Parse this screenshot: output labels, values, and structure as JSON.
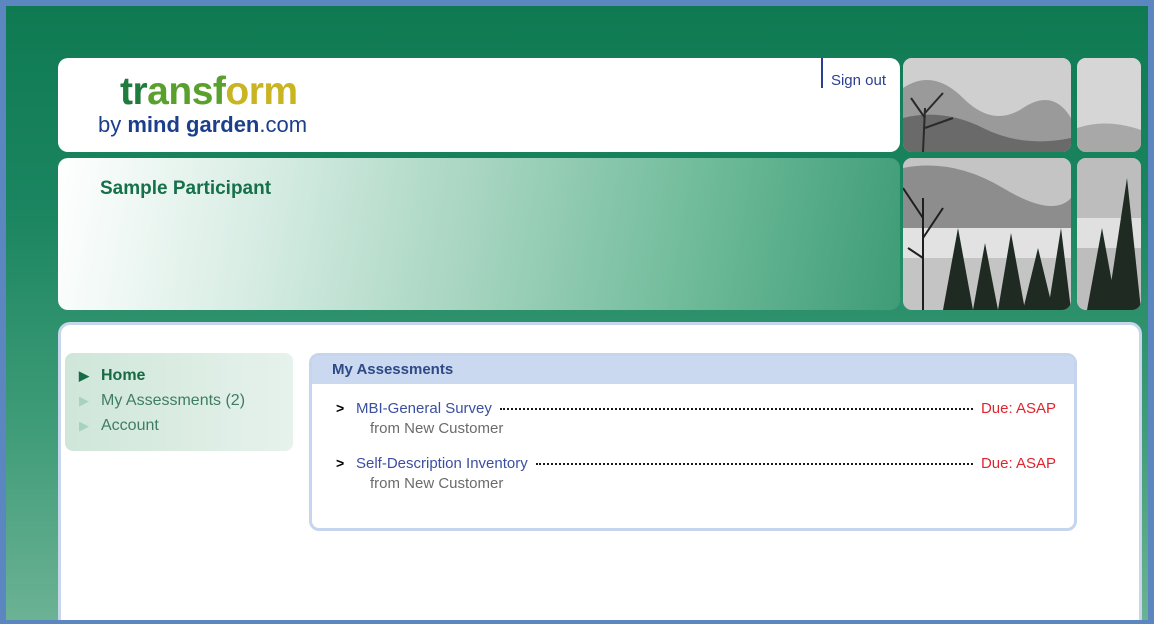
{
  "header": {
    "logo": {
      "word": [
        "tr",
        "a",
        "nsf",
        "o",
        "rm"
      ],
      "byline_prefix": "by ",
      "byline_bold": "mind garden",
      "byline_suffix": ".com"
    },
    "sign_out_label": "Sign out"
  },
  "banner": {
    "participant_name": "Sample Participant"
  },
  "nav": {
    "items": [
      {
        "label": "Home",
        "active": true
      },
      {
        "label": "My Assessments (2)",
        "active": false
      },
      {
        "label": "Account",
        "active": false
      }
    ]
  },
  "assessments": {
    "title": "My Assessments",
    "items": [
      {
        "name": "MBI-General Survey",
        "from": "from New Customer",
        "due": "Due: ASAP"
      },
      {
        "name": "Self-Description Inventory",
        "from": "from New Customer",
        "due": "Due: ASAP"
      }
    ]
  },
  "colors": {
    "page_border": "#5b86c0",
    "background_green": "#0f7a52",
    "accent_link": "#3b4fa0",
    "due_red": "#e0242e",
    "participant_green": "#16704a"
  },
  "icons": {
    "nav_arrow": "triangle-right",
    "list_bullet": "chevron-right"
  }
}
